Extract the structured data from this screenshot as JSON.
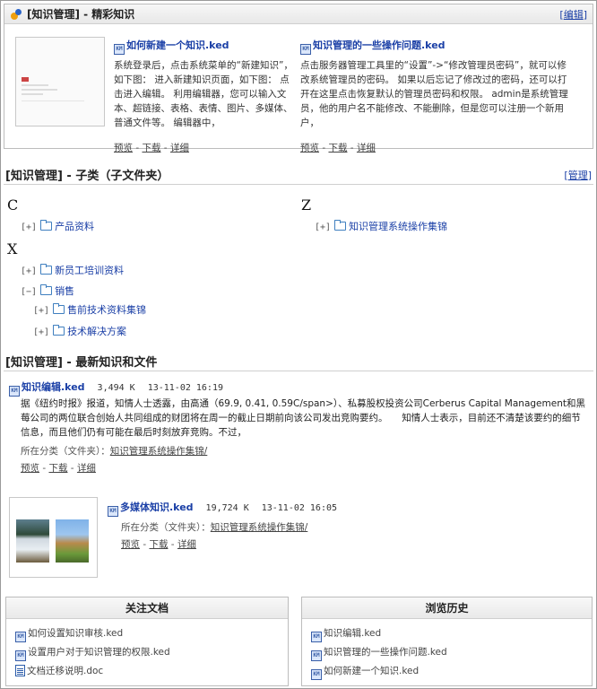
{
  "featured": {
    "title": "[知识管理] - 精彩知识",
    "edit_link": "编辑",
    "articles": [
      {
        "title": "如何新建一个知识.ked",
        "body": "系统登录后，点击系统菜单的“新建知识”，如下图： 进入新建知识页面，如下图： 点击进入编辑。 利用编辑器，您可以输入文本、超链接、表格、表情、图片、多媒体、普通文件等。 编辑器中，",
        "preview": "预览",
        "download": "下载",
        "detail": "详细"
      },
      {
        "title": "知识管理的一些操作问题.ked",
        "body": "点击服务器管理工具里的“设置”->“修改管理员密码”，就可以修改系统管理员的密码。 如果以后忘记了修改过的密码，还可以打开在这里点击恢复默认的管理员密码和权限。 admin是系统管理员，他的用户名不能修改、不能删除，但是您可以注册一个新用户，",
        "preview": "预览",
        "download": "下载",
        "detail": "详细"
      }
    ]
  },
  "subcats": {
    "title": "[知识管理] - 子类（子文件夹）",
    "manage_link": "管理",
    "groups": [
      {
        "letter": "C",
        "items": [
          {
            "toggle": "[+]",
            "name": "产品资料"
          }
        ]
      },
      {
        "letter": "Z",
        "items": [
          {
            "toggle": "[+]",
            "name": "知识管理系统操作集锦"
          }
        ]
      },
      {
        "letter": "X",
        "items": [
          {
            "toggle": "[+]",
            "name": "新员工培训资料"
          },
          {
            "toggle": "[−]",
            "name": "销售"
          },
          {
            "toggle": "[+]",
            "name": "售前技术资料集锦"
          },
          {
            "toggle": "[+]",
            "name": "技术解决方案"
          }
        ]
      }
    ]
  },
  "latest": {
    "title": "[知识管理] - 最新知识和文件",
    "items": [
      {
        "title": "知识编辑.ked",
        "size": "3,494 K",
        "date": "13-11-02 16:19",
        "desc": "据《纽约时报》报道，知情人士透露，由高通（69.9, 0.41, 0.59C/span>）、私募股权投资公司Cerberus Capital Management和黑莓公司的两位联合创始人共同组成的财团将在周一的截止日期前向该公司发出竞购要约。　　知情人士表示，目前还不清楚该要约的细节信息，而且他们仍有可能在最后时刻放弃竞购。不过，",
        "category_label": "所在分类（文件夹）：",
        "category": "知识管理系统操作集锦/",
        "preview": "预览",
        "download": "下载",
        "detail": "详细"
      },
      {
        "title": "多媒体知识.ked",
        "size": "19,724 K",
        "date": "13-11-02 16:05",
        "category_label": "所在分类（文件夹）：",
        "category": "知识管理系统操作集锦/",
        "preview": "预览",
        "download": "下载",
        "detail": "详细"
      }
    ]
  },
  "followed": {
    "title": "关注文档",
    "items": [
      "如何设置知识审核.ked",
      "设置用户对于知识管理的权限.ked",
      "文档迁移说明.doc"
    ]
  },
  "history": {
    "title": "浏览历史",
    "items": [
      "知识编辑.ked",
      "知识管理的一些操作问题.ked",
      "如何新建一个知识.ked"
    ]
  },
  "icons": {
    "file": "ked-file-icon",
    "doc": "word-doc-icon",
    "folder": "folder-icon",
    "logo": "app-logo-icon"
  },
  "colors": {
    "link": "#1a3fa6",
    "header_bg": "#e8e8e8",
    "border": "#bcbcbc"
  }
}
